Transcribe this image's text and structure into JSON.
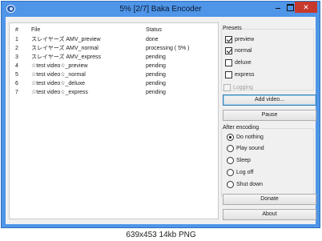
{
  "window": {
    "title": "5% [2/7] Baka Encoder"
  },
  "table": {
    "headers": {
      "num": "#",
      "file": "File",
      "status": "Status"
    },
    "rows": [
      {
        "num": "1",
        "file": "スレイヤーズ AMV_preview",
        "status": "done"
      },
      {
        "num": "2",
        "file": "スレイヤーズ AMV_normal",
        "status": "processing ( 5% )"
      },
      {
        "num": "3",
        "file": "スレイヤーズ AMV_express",
        "status": "pending"
      },
      {
        "num": "4",
        "file": "☆test video☆_preview",
        "status": "pending"
      },
      {
        "num": "5",
        "file": "☆test video☆_normal",
        "status": "pending"
      },
      {
        "num": "6",
        "file": "☆test video☆_deluxe",
        "status": "pending"
      },
      {
        "num": "7",
        "file": "☆test video☆_express",
        "status": "pending"
      }
    ]
  },
  "presets": {
    "label": "Presets",
    "items": [
      {
        "label": "preview",
        "checked": true
      },
      {
        "label": "normal",
        "checked": true
      },
      {
        "label": "deluxe",
        "checked": false
      },
      {
        "label": "express",
        "checked": false
      }
    ]
  },
  "logging": {
    "label": "Logging",
    "checked": false,
    "enabled": false
  },
  "buttons": {
    "add_video": "Add video...",
    "pause": "Pause",
    "donate": "Donate",
    "about": "About"
  },
  "after_encoding": {
    "label": "After encoding",
    "options": [
      {
        "label": "Do nothing",
        "selected": true
      },
      {
        "label": "Play sound",
        "selected": false
      },
      {
        "label": "Sleep",
        "selected": false
      },
      {
        "label": "Log off",
        "selected": false
      },
      {
        "label": "Shut down",
        "selected": false
      }
    ]
  },
  "footer": {
    "caption": "639x453 14kb PNG"
  }
}
